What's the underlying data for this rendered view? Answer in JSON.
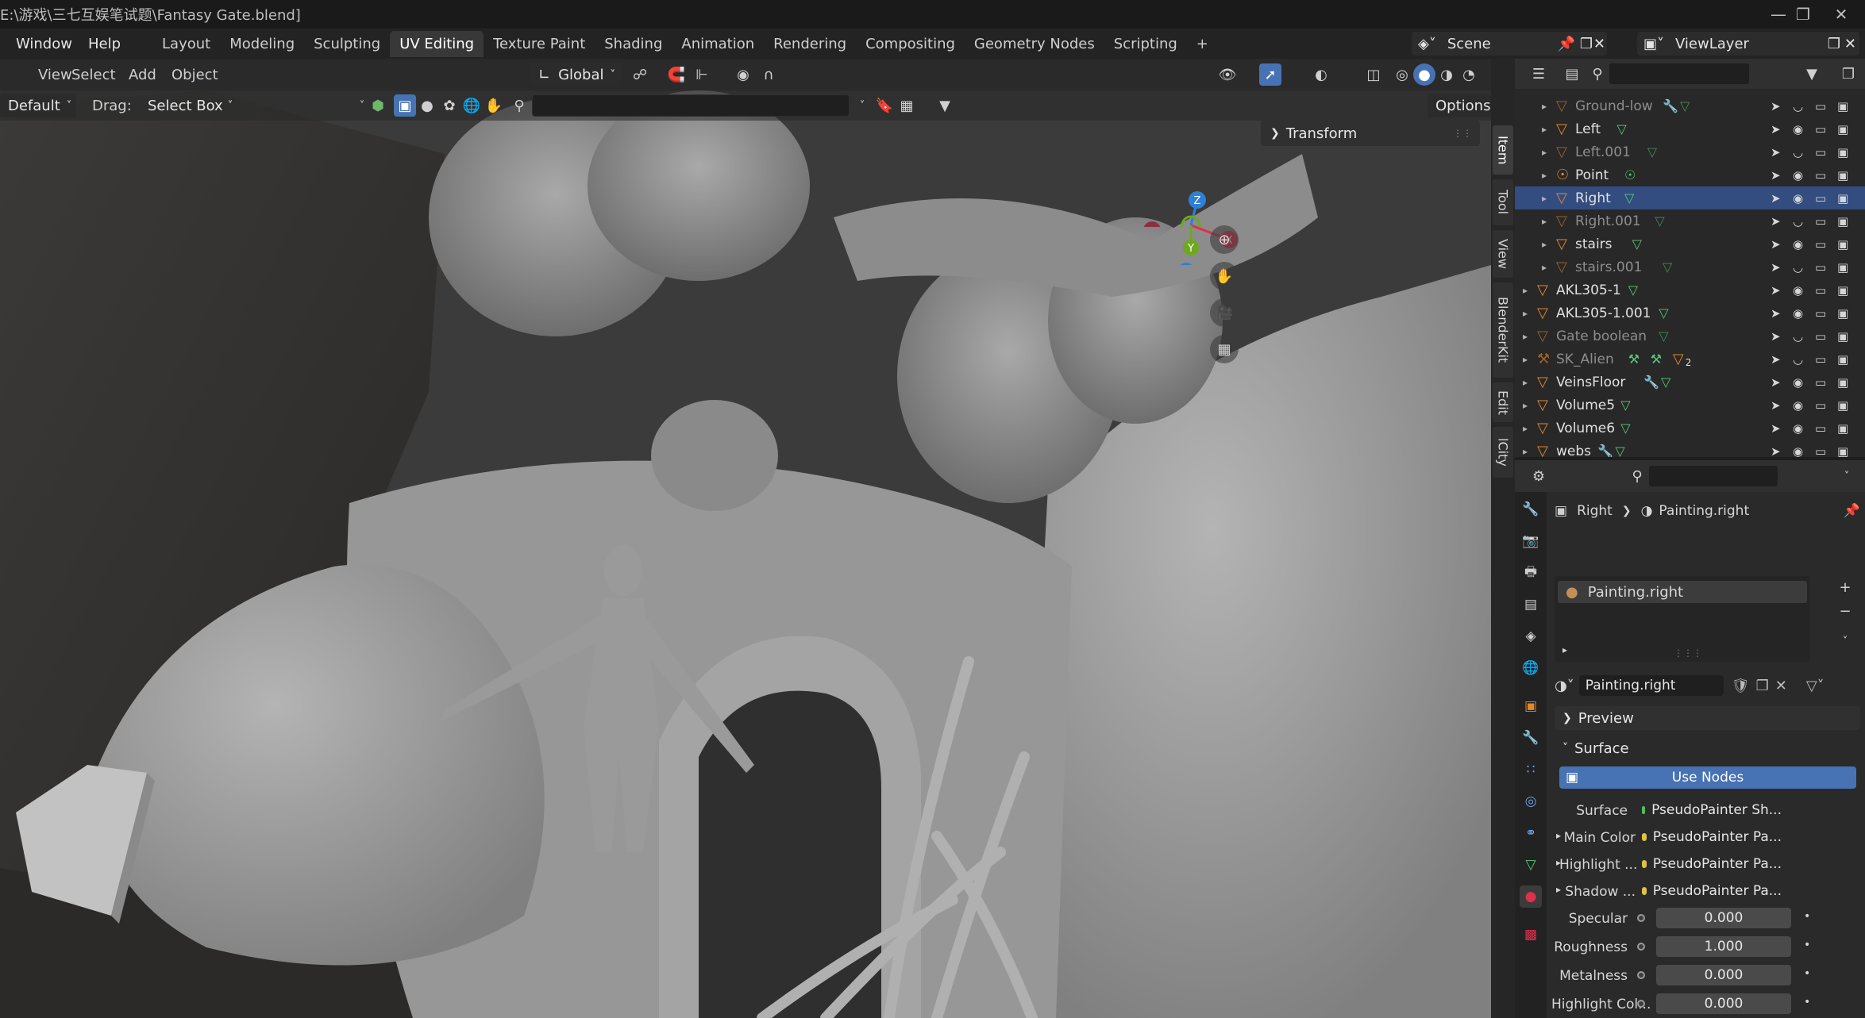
{
  "window": {
    "title": "C:\\Users\\...\\游戏\\三七互娱笔试题\\Fantasy Gate.blend]",
    "title_visible": "E:\\游戏\\三七互娱笔试题\\Fantasy Gate.blend]"
  },
  "menu": {
    "window": "Window",
    "help": "Help"
  },
  "workspaces": [
    "Layout",
    "Modeling",
    "Sculpting",
    "UV Editing",
    "Texture Paint",
    "Shading",
    "Animation",
    "Rendering",
    "Compositing",
    "Geometry Nodes",
    "Scripting",
    "+"
  ],
  "active_workspace": "UV Editing",
  "scene": {
    "name": "Scene",
    "view_layer": "ViewLayer"
  },
  "viewport": {
    "menus": [
      "View",
      "Select",
      "Add",
      "Object"
    ],
    "mode_label": "Default",
    "drag_label": "Drag:",
    "drag_value": "Select Box",
    "transform_orientation": "Global",
    "options_label": "Options",
    "n_panel_header": "Transform",
    "side_tabs": [
      "Item",
      "Tool",
      "View",
      "BlenderKit",
      "Edit",
      "lCity"
    ],
    "gizmo": {
      "x": "X",
      "y": "Y",
      "z": "Z"
    }
  },
  "outliner": {
    "rows": [
      {
        "name": "Ground-low",
        "dim": true,
        "indent": 1,
        "extra": "mod+mesh",
        "selected": false
      },
      {
        "name": "Left",
        "dim": false,
        "indent": 1,
        "extra": "mesh",
        "selected": false
      },
      {
        "name": "Left.001",
        "dim": true,
        "indent": 1,
        "extra": "mesh",
        "selected": false
      },
      {
        "name": "Point",
        "dim": false,
        "indent": 1,
        "extra": "light",
        "selected": false
      },
      {
        "name": "Right",
        "dim": false,
        "indent": 1,
        "extra": "mesh",
        "selected": true
      },
      {
        "name": "Right.001",
        "dim": true,
        "indent": 1,
        "extra": "mesh",
        "selected": false
      },
      {
        "name": "stairs",
        "dim": false,
        "indent": 1,
        "extra": "mesh",
        "selected": false
      },
      {
        "name": "stairs.001",
        "dim": true,
        "indent": 1,
        "extra": "mesh",
        "selected": false
      },
      {
        "name": "AKL305-1",
        "dim": false,
        "indent": 0,
        "extra": "mesh",
        "selected": false
      },
      {
        "name": "AKL305-1.001",
        "dim": false,
        "indent": 0,
        "extra": "mesh",
        "selected": false
      },
      {
        "name": "Gate boolean",
        "dim": true,
        "indent": 0,
        "extra": "mesh",
        "selected": false
      },
      {
        "name": "SK_Alien",
        "dim": true,
        "indent": 0,
        "extra": "armature",
        "selected": false
      },
      {
        "name": "VeinsFloor",
        "dim": false,
        "indent": 0,
        "extra": "mod+mesh",
        "selected": false
      },
      {
        "name": "Volume5",
        "dim": false,
        "indent": 0,
        "extra": "mesh",
        "selected": false
      },
      {
        "name": "Volume6",
        "dim": false,
        "indent": 0,
        "extra": "mesh",
        "selected": false
      },
      {
        "name": "webs",
        "dim": false,
        "indent": 0,
        "extra": "mod+mesh",
        "selected": false
      }
    ],
    "sk_alien_count": "2"
  },
  "properties": {
    "breadcrumb_object": "Right",
    "breadcrumb_material": "Painting.right",
    "slot_name": "Painting.right",
    "material_name": "Painting.right",
    "sections": {
      "preview": "Preview",
      "surface": "Surface"
    },
    "use_nodes": "Use Nodes",
    "fields": [
      {
        "label": "Surface",
        "value": "PseudoPainter Sh...",
        "type": "link",
        "dot": "#4fbf5a",
        "expand": false
      },
      {
        "label": "Main Color",
        "value": "PseudoPainter Pa...",
        "type": "link",
        "dot": "#e0c341",
        "expand": true
      },
      {
        "label": "Highlight ...",
        "value": "PseudoPainter Pa...",
        "type": "link",
        "dot": "#e0c341",
        "expand": true
      },
      {
        "label": "Shadow ...",
        "value": "PseudoPainter Pa...",
        "type": "link",
        "dot": "#e0c341",
        "expand": true
      },
      {
        "label": "Specular",
        "value": "0.000",
        "type": "num",
        "dot": "#9a9a9a",
        "expand": false
      },
      {
        "label": "Roughness",
        "value": "1.000",
        "type": "num",
        "dot": "#9a9a9a",
        "expand": false
      },
      {
        "label": "Metalness",
        "value": "0.000",
        "type": "num",
        "dot": "#9a9a9a",
        "expand": false
      },
      {
        "label": "Highlight Col...",
        "value": "0.000",
        "type": "num",
        "dot": "#9a9a9a",
        "expand": false
      }
    ]
  },
  "colors": {
    "accent": "#4772b3",
    "selection": "#334d80",
    "object_orange": "#e4862c",
    "mesh_green": "#5bc77d",
    "axis_x": "#e0304d",
    "axis_y": "#6ea81f",
    "axis_z": "#2e7fd6"
  }
}
